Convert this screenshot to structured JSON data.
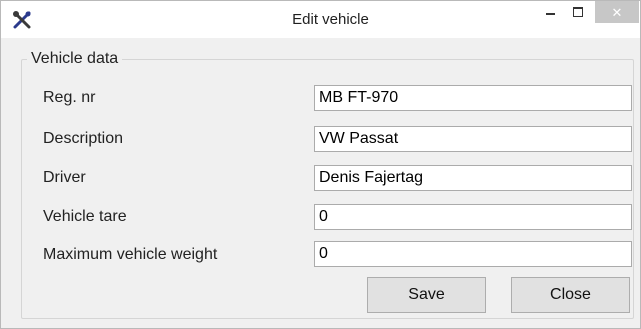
{
  "window": {
    "title": "Edit vehicle",
    "icon": "crossed-tools-icon",
    "controls": {
      "minimize": "minimize-icon",
      "maximize": "maximize-icon",
      "close": "close-icon"
    },
    "close_glyph": "✕"
  },
  "group": {
    "label": "Vehicle data"
  },
  "fields": [
    {
      "label": "Reg. nr",
      "value": "MB FT-970"
    },
    {
      "label": "Description",
      "value": "VW Passat"
    },
    {
      "label": "Driver",
      "value": "Denis Fajertag"
    },
    {
      "label": "Vehicle tare",
      "value": "0"
    },
    {
      "label": "Maximum vehicle weight",
      "value": "0"
    }
  ],
  "buttons": {
    "save": "Save",
    "close": "Close"
  },
  "colors": {
    "window_bg": "#f0f0f0",
    "close_button_bg": "#c7c7c7",
    "input_border": "#ababab"
  }
}
